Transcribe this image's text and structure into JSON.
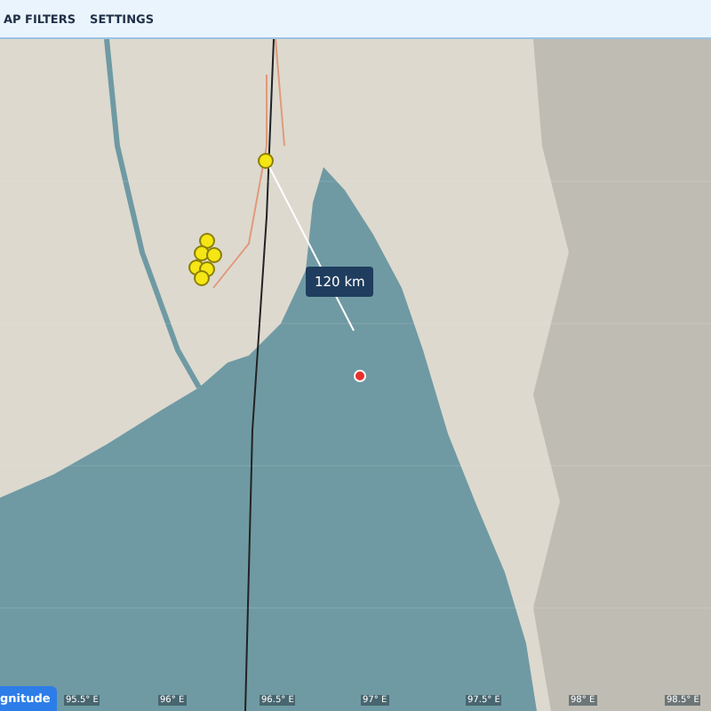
{
  "header": {
    "tabs": [
      {
        "label": "AP FILTERS"
      },
      {
        "label": "SETTINGS"
      }
    ]
  },
  "map": {
    "distance_label": "120 km",
    "legend_button": "gnitude",
    "longitude_labels": [
      "95.5° E",
      "96° E",
      "96.5° E",
      "97° E",
      "97.5° E",
      "98° E",
      "98.5° E"
    ]
  }
}
